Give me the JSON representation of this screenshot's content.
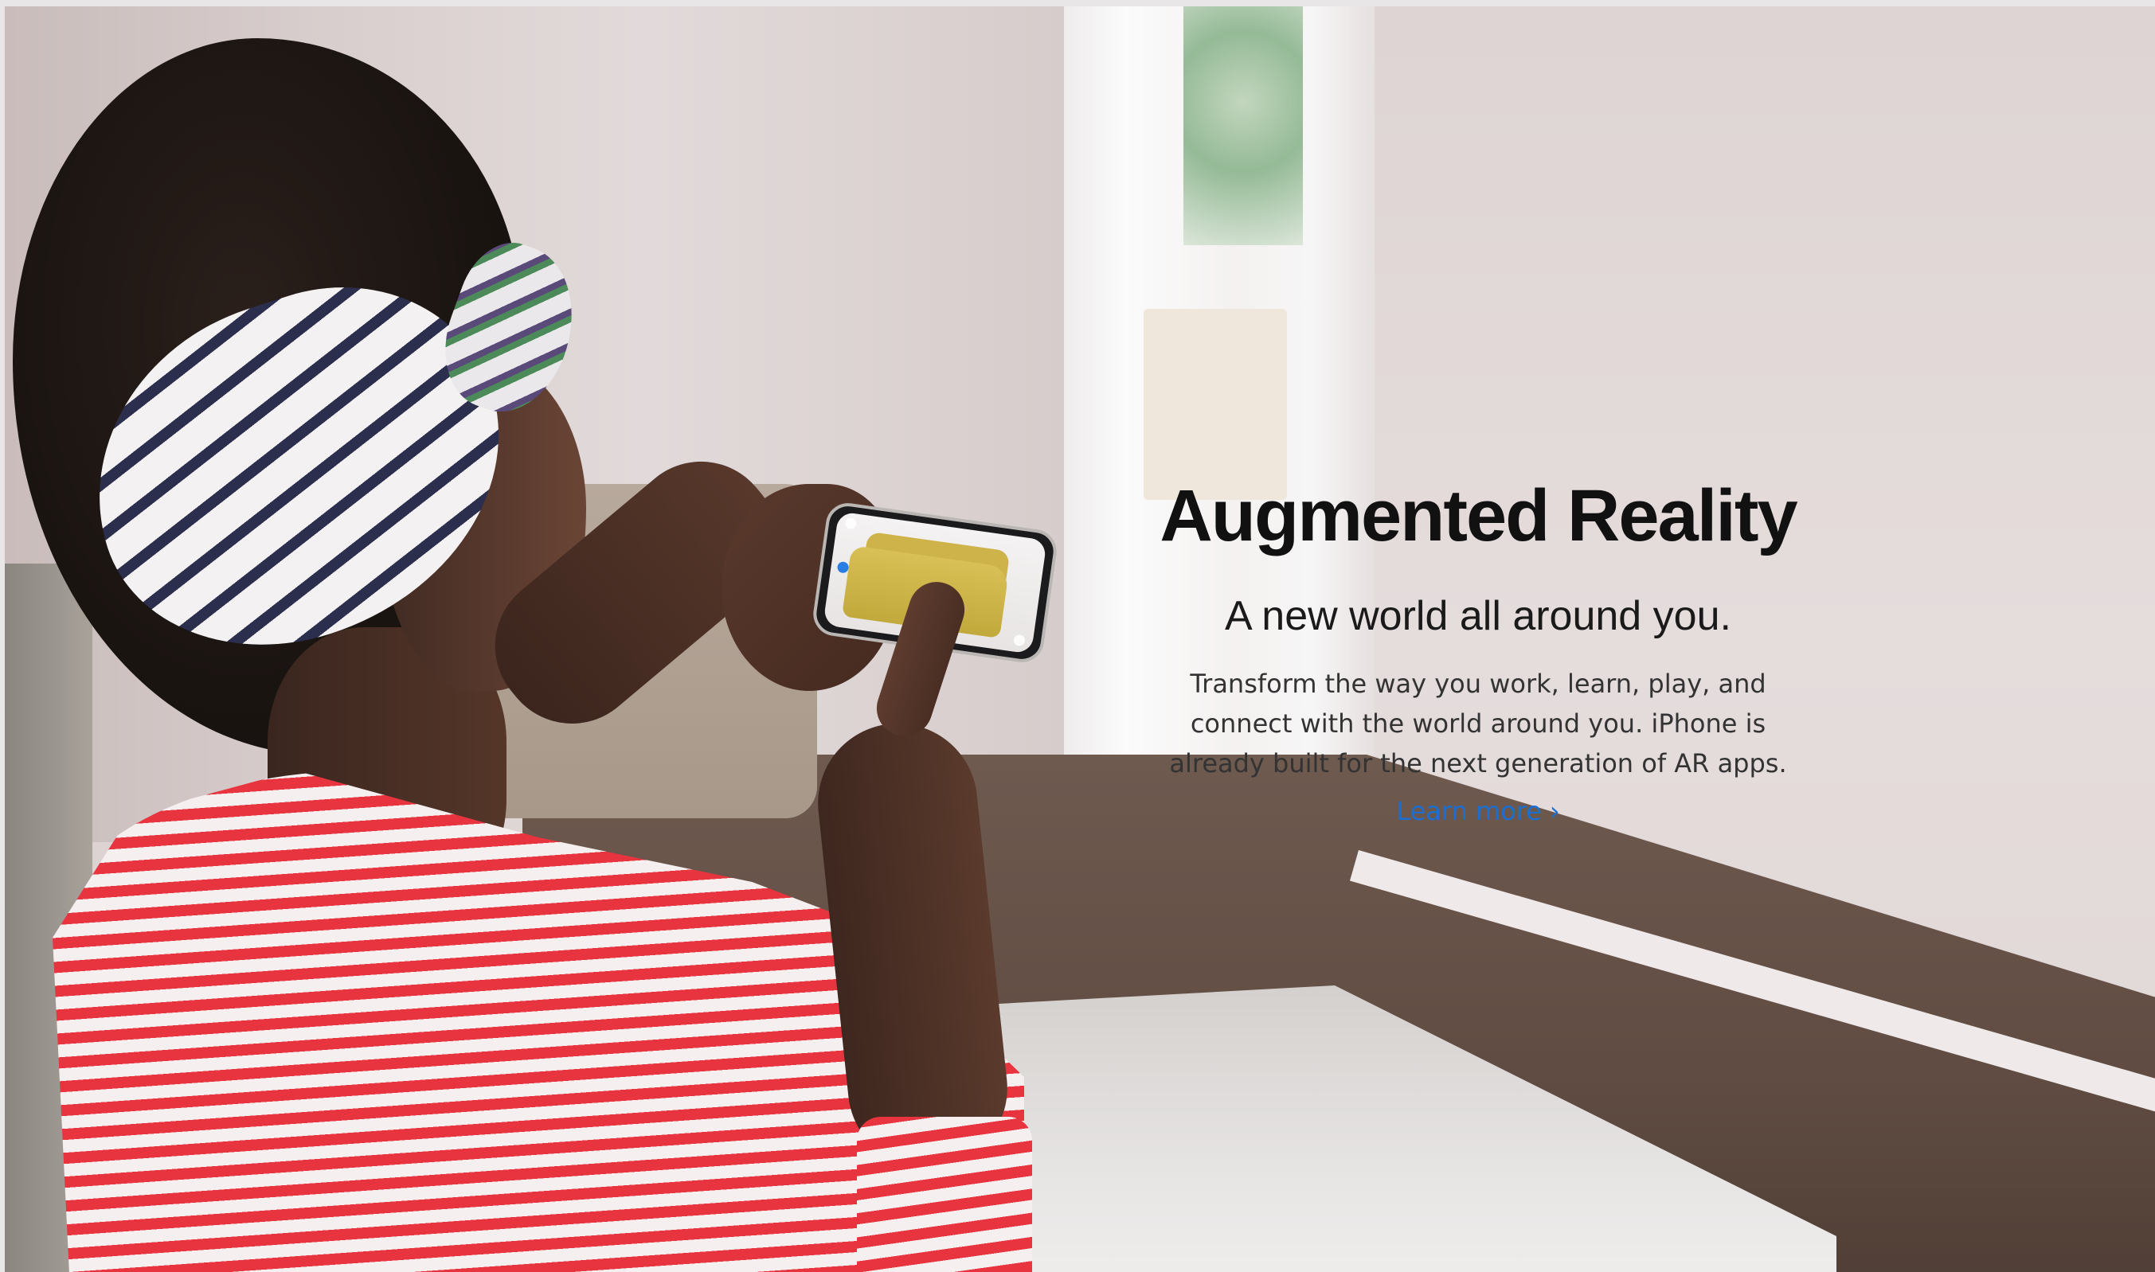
{
  "hero": {
    "headline": "Augmented Reality",
    "subhead": "A new world all around you.",
    "body": "Transform the way you work, learn, play, and connect with the world around you. iPhone is already built for the next generation of AR apps.",
    "link_label": "Learn more",
    "link_chevron": "›",
    "colors": {
      "headline": "#111111",
      "body": "#333333",
      "link": "#1c6fd0"
    }
  },
  "icons": {
    "link_chevron": "chevron-right-icon"
  }
}
